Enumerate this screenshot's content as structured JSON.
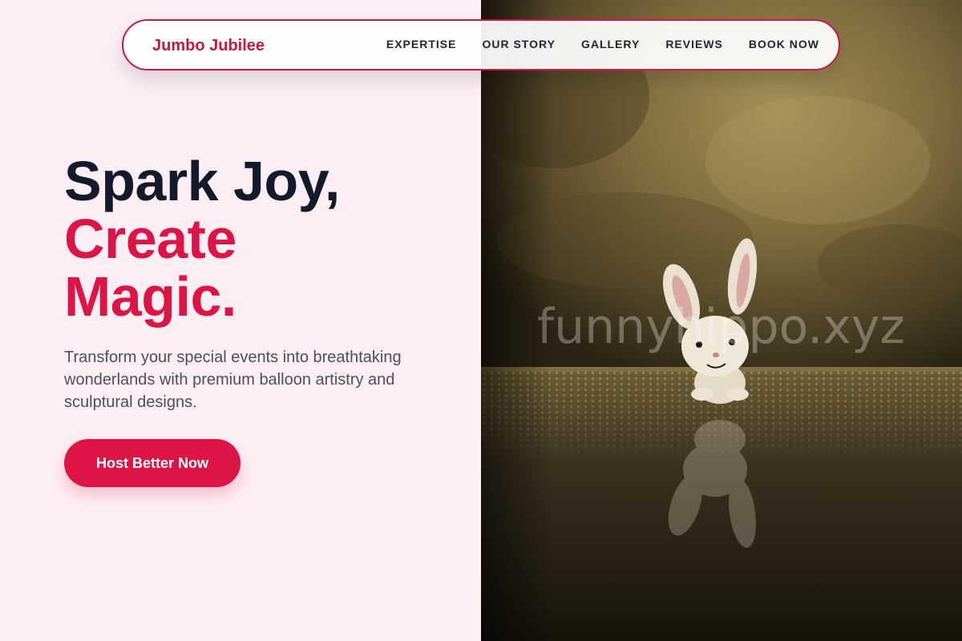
{
  "nav": {
    "brand": "Jumbo Jubilee",
    "links": [
      "EXPERTISE",
      "OUR STORY",
      "GALLERY",
      "REVIEWS",
      "BOOK NOW"
    ]
  },
  "hero": {
    "title_line1": "Spark Joy,",
    "title_line2": "Create",
    "title_line3": "Magic.",
    "subtitle": "Transform your special events into breathtaking wonderlands with premium balloon artistry and sculptural designs.",
    "cta_label": "Host Better Now"
  },
  "image": {
    "watermark": "funnyhippo.xyz",
    "subject": "toy-bunny-photo"
  },
  "colors": {
    "accent": "#dc1546",
    "brand": "#c8193f",
    "heading": "#121a2c",
    "body_text": "#4b5060",
    "background": "#fdeef4"
  }
}
